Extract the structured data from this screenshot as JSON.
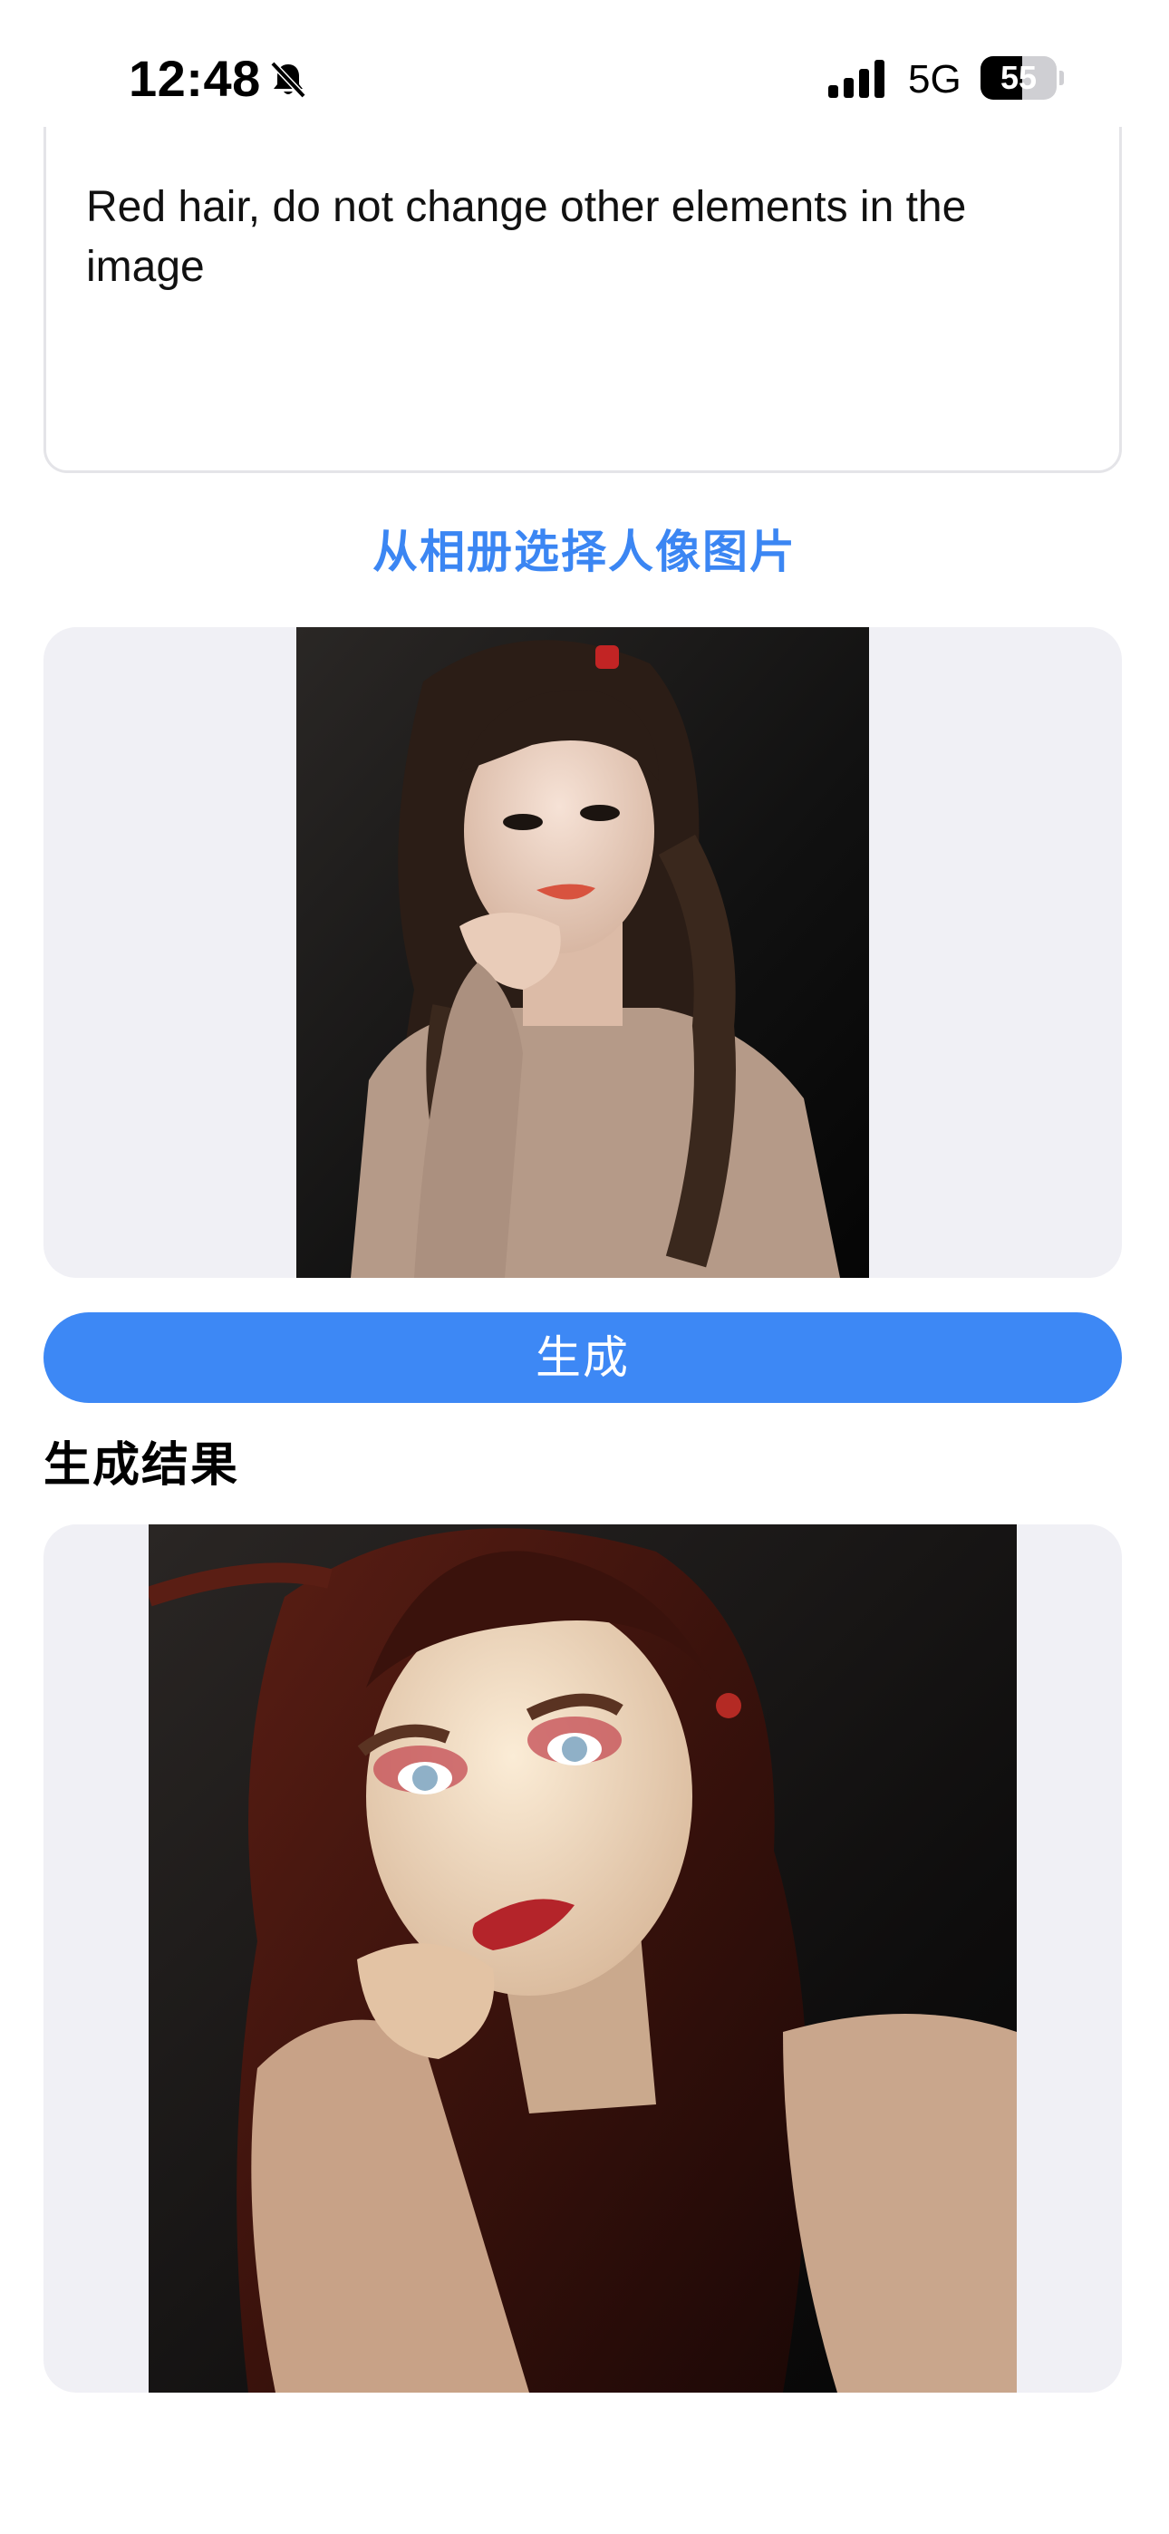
{
  "status_bar": {
    "time": "12:48",
    "network": "5G",
    "battery_level": "55",
    "battery_fraction": 0.55,
    "icons": [
      "bell-muted-icon",
      "cellular-signal-icon",
      "battery-icon"
    ]
  },
  "prompt": {
    "text": "Red hair, do not change other elements in the image"
  },
  "album_link": {
    "label": "从相册选择人像图片"
  },
  "source_image": {
    "description": "selected portrait photo"
  },
  "generate_button": {
    "label": "生成"
  },
  "result": {
    "title": "生成结果"
  },
  "colors": {
    "accent": "#3d88f5",
    "link": "#3b86f3",
    "panel_background": "#f0f0f5"
  }
}
